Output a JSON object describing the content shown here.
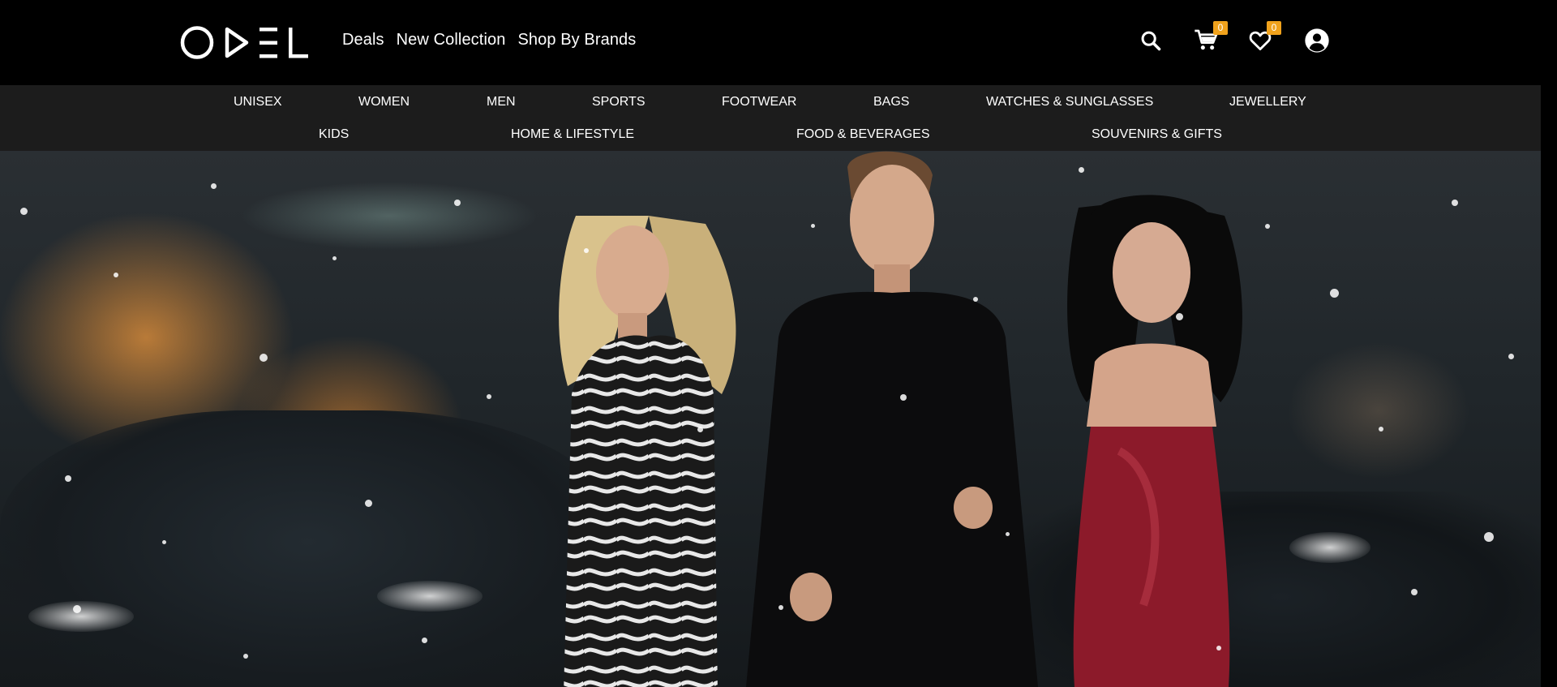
{
  "header": {
    "logo_text": "ODEL",
    "nav": [
      {
        "label": "Deals"
      },
      {
        "label": "New Collection"
      },
      {
        "label": "Shop By Brands"
      }
    ],
    "cart_count": "0",
    "wishlist_count": "0",
    "badge_color": "#f0a21c"
  },
  "categories": {
    "row1": [
      "UNISEX",
      "WOMEN",
      "MEN",
      "SPORTS",
      "FOOTWEAR",
      "BAGS",
      "WATCHES & SUNGLASSES",
      "JEWELLERY"
    ],
    "row2": [
      "KIDS",
      "HOME & LIFESTYLE",
      "FOOD & BEVERAGES",
      "SOUVENIRS & GIFTS"
    ]
  },
  "icons": {
    "search": "search-icon",
    "cart": "cart-icon",
    "wishlist": "heart-icon",
    "account": "account-icon"
  }
}
